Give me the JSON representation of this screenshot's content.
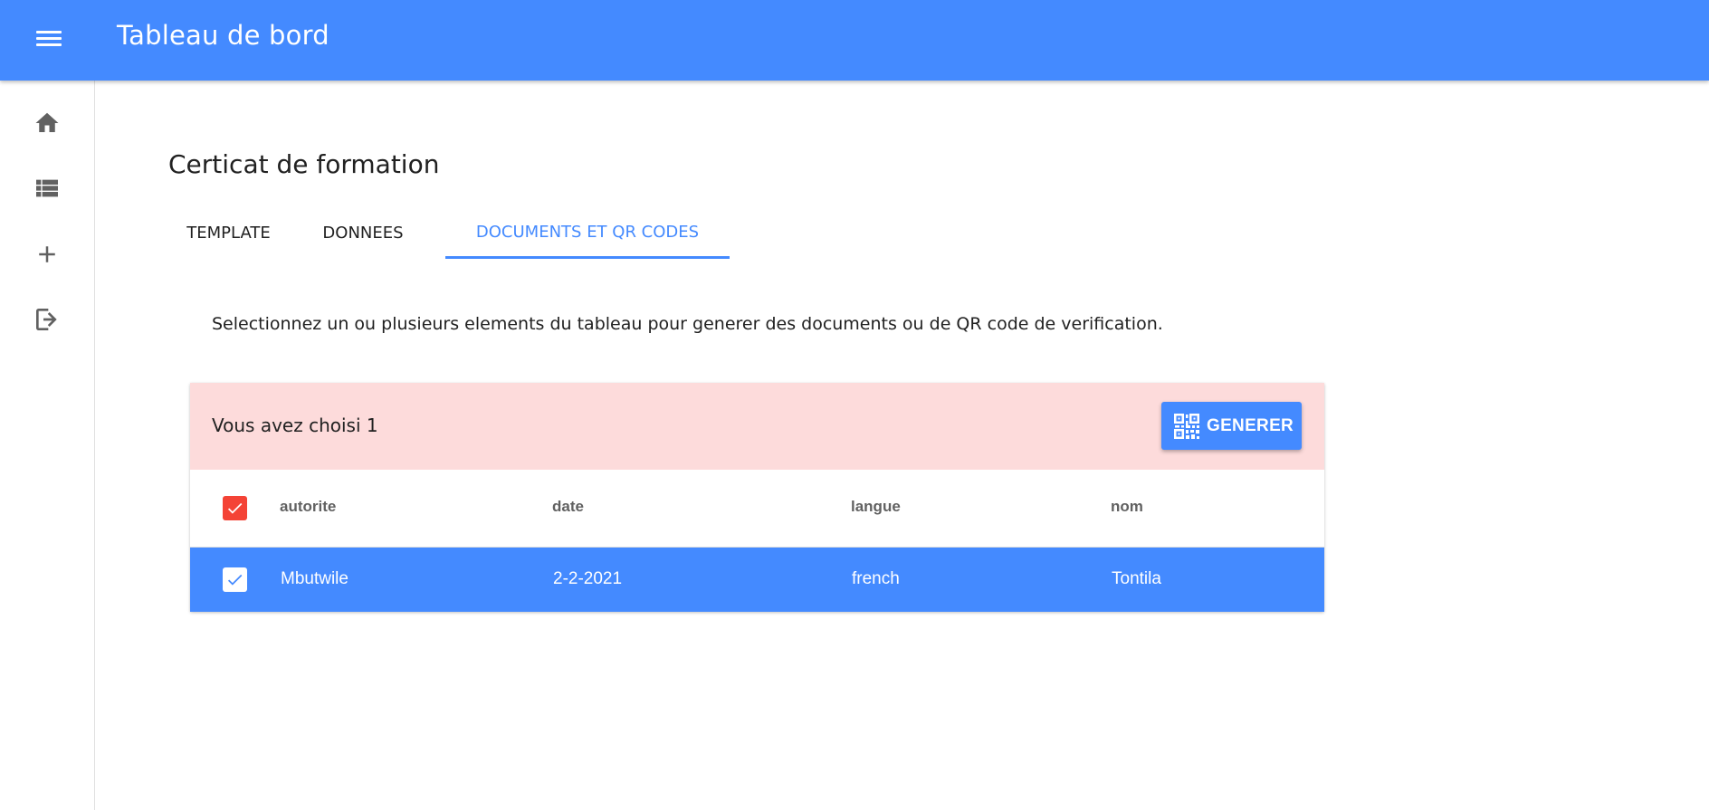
{
  "appbar": {
    "title": "Tableau de bord",
    "menu_icon": "menu-icon",
    "color": "#448aff"
  },
  "sidebar": {
    "items": [
      {
        "icon": "home-icon"
      },
      {
        "icon": "list-icon"
      },
      {
        "icon": "add-icon"
      },
      {
        "icon": "logout-icon"
      }
    ]
  },
  "main": {
    "page_title": "Certicat de formation",
    "tabs": [
      {
        "label": "TEMPLATE",
        "active": false
      },
      {
        "label": "DONNEES",
        "active": false
      },
      {
        "label": "DOCUMENTS ET QR CODES",
        "active": true
      }
    ],
    "instruction": "Selectionnez un ou plusieurs elements du tableau pour generer des documents ou de QR code de verification.",
    "selection": {
      "text": "Vous avez choisi 1",
      "color": "#fddbdb"
    },
    "generate_button": {
      "label": "GENERER",
      "icon": "qr-code-icon"
    },
    "table": {
      "columns": [
        "autorite",
        "date",
        "langue",
        "nom"
      ],
      "all_selected": true,
      "rows": [
        {
          "selected": true,
          "cells": [
            "Mbutwile",
            "2-2-2021",
            "french",
            "Tontila"
          ]
        }
      ]
    }
  },
  "colors": {
    "accent": "#448aff",
    "selected_checkbox_header": "#f44336"
  }
}
